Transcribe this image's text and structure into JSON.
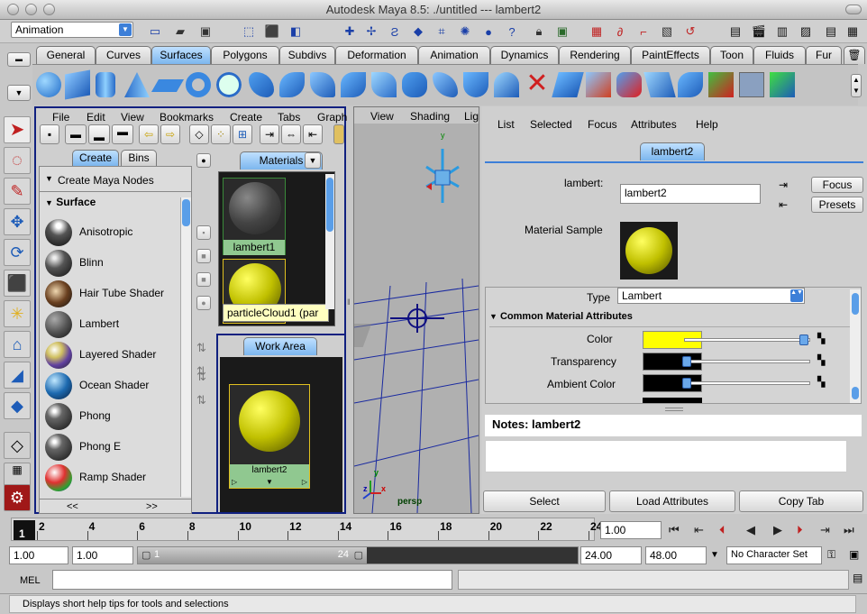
{
  "window": {
    "title": "Autodesk Maya 8.5: ./untitled   ---   lambert2"
  },
  "statusline": {
    "mode": "Animation"
  },
  "shelf_tabs": [
    "General",
    "Curves",
    "Surfaces",
    "Polygons",
    "Subdivs",
    "Deformation",
    "Animation",
    "Dynamics",
    "Rendering",
    "PaintEffects",
    "Toon",
    "Fluids",
    "Fur"
  ],
  "hypershade": {
    "menu": [
      "File",
      "Edit",
      "View",
      "Bookmarks",
      "Create",
      "Tabs",
      "Graph"
    ],
    "create_tab": "Create",
    "bins_tab": "Bins",
    "create_maya_nodes": "Create Maya Nodes",
    "surface_header": "Surface",
    "nodes": [
      "Anisotropic",
      "Blinn",
      "Hair Tube Shader",
      "Lambert",
      "Layered Shader",
      "Ocean Shader",
      "Phong",
      "Phong E",
      "Ramp Shader"
    ],
    "scroll_left": "<<",
    "scroll_right": ">>",
    "materials_tab": "Materials",
    "material1": "lambert1",
    "material2": "particleCloud1 (par",
    "work_area_tab": "Work Area",
    "work_node": "lambert2"
  },
  "viewport": {
    "menu": [
      "View",
      "Shading",
      "Lig"
    ],
    "camera": "persp",
    "axis_x": "x",
    "axis_y": "y",
    "axis_z": "z"
  },
  "attribute_editor": {
    "menu": [
      "List",
      "Selected",
      "Focus",
      "Attributes",
      "Help"
    ],
    "tab": "lambert2",
    "name_label": "lambert:",
    "name_value": "lambert2",
    "focus_button": "Focus",
    "presets_button": "Presets",
    "material_sample_label": "Material Sample",
    "type_label": "Type",
    "type_value": "Lambert",
    "section": "Common Material Attributes",
    "color_label": "Color",
    "transparency_label": "Transparency",
    "ambient_label": "Ambient Color",
    "color_hex": "#ffff00",
    "notes_label": "Notes:  lambert2",
    "select_button": "Select",
    "load_button": "Load Attributes",
    "copy_button": "Copy Tab"
  },
  "timeline": {
    "ticks": [
      "2",
      "4",
      "6",
      "8",
      "10",
      "12",
      "14",
      "16",
      "18",
      "20",
      "22",
      "24"
    ],
    "current_frame": "1",
    "current_time": "1.00"
  },
  "range": {
    "start": "1.00",
    "playback_start": "1.00",
    "slider_start": "1",
    "slider_end": "24",
    "playback_end": "24.00",
    "end": "48.00",
    "character_set": "No Character Set"
  },
  "mel": {
    "label": "MEL"
  },
  "help": {
    "text": "Displays short help tips for tools and selections"
  }
}
